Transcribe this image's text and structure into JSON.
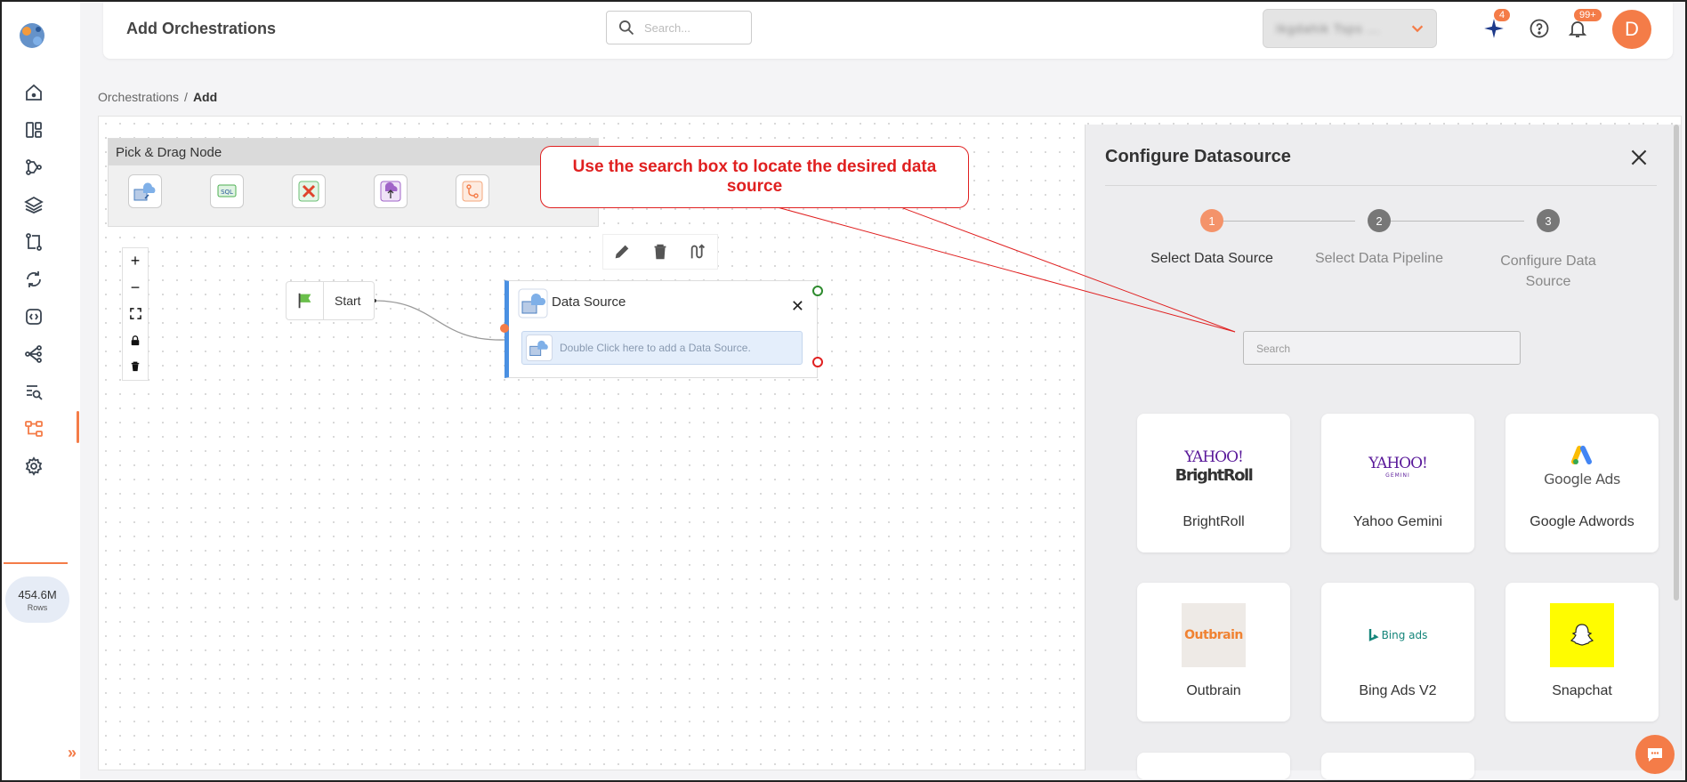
{
  "header": {
    "title": "Add Orchestrations",
    "search_placeholder": "Search...",
    "account_name": "Ikgdahik Tsps ...",
    "ai_badge": "4",
    "notif_badge": "99+",
    "avatar_letter": "D"
  },
  "sidebar": {
    "rows_value": "454.6M",
    "rows_label": "Rows"
  },
  "breadcrumb": {
    "parent": "Orchestrations",
    "separator": "/",
    "current": "Add"
  },
  "palette": {
    "title": "Pick & Drag Node"
  },
  "canvas": {
    "start_label": "Start",
    "datasource_title": "Data Source",
    "datasource_hint": "Double Click here to add a Data Source."
  },
  "panel": {
    "title": "Configure Datasource",
    "steps": [
      {
        "num": "1",
        "label": "Select Data Source"
      },
      {
        "num": "2",
        "label": "Select Data Pipeline"
      },
      {
        "num": "3",
        "label": "Configure Data Source"
      }
    ],
    "search_placeholder": "Search",
    "sources": [
      {
        "name": "BrightRoll",
        "logo_top": "YAHOO!",
        "logo_bottom": "BrightRoll"
      },
      {
        "name": "Yahoo Gemini",
        "logo_top": "YAHOO!",
        "logo_bottom": "GEMINI"
      },
      {
        "name": "Google Adwords",
        "logo_text": "Google Ads"
      },
      {
        "name": "Outbrain",
        "logo_text": "Outbrain"
      },
      {
        "name": "Bing Ads V2",
        "logo_text": "Bing ads"
      },
      {
        "name": "Snapchat"
      }
    ]
  },
  "annotation": {
    "text": "Use the search box to locate the desired data source"
  },
  "colors": {
    "accent": "#f47c48",
    "annotation": "#e02020",
    "node_border": "#4a90e2"
  }
}
